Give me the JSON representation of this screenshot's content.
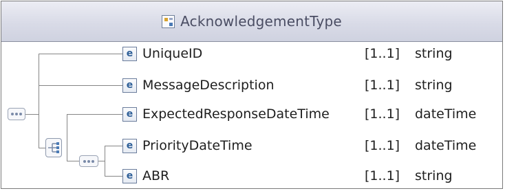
{
  "type_name": "AcknowledgementType",
  "elements": [
    {
      "icon": "e",
      "name": "UniqueID",
      "cardinality": "[1..1]",
      "type": "string"
    },
    {
      "icon": "e",
      "name": "MessageDescription",
      "cardinality": "[1..1]",
      "type": "string"
    },
    {
      "icon": "e",
      "name": "ExpectedResponseDateTime",
      "cardinality": "[1..1]",
      "type": "dateTime"
    },
    {
      "icon": "e",
      "name": "PriorityDateTime",
      "cardinality": "[1..1]",
      "type": "dateTime"
    },
    {
      "icon": "e",
      "name": "ABR",
      "cardinality": "[1..1]",
      "type": "string"
    }
  ]
}
